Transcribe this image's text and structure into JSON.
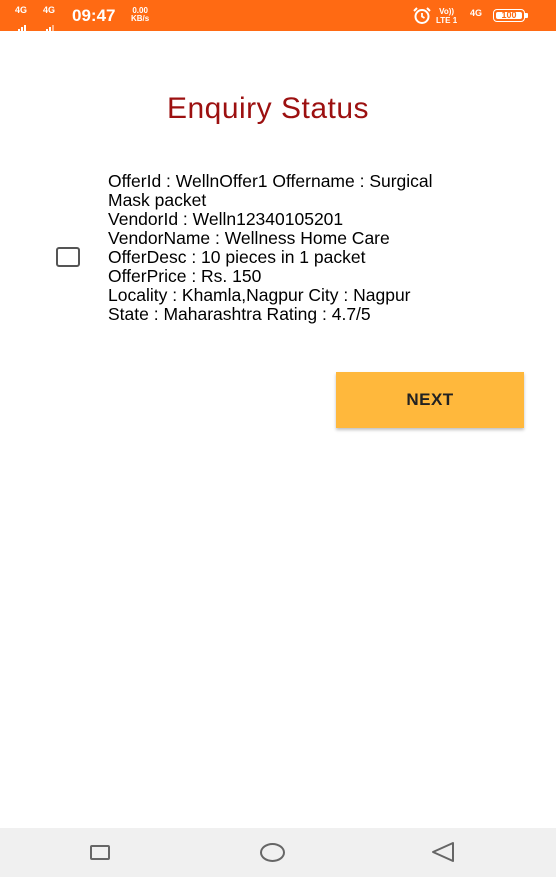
{
  "status_bar": {
    "network_1": "4G",
    "network_2": "4G",
    "time": "09:47",
    "speed_value": "0.00",
    "speed_unit": "KB/s",
    "volte_top": "Vo))",
    "volte_bottom": "LTE 1",
    "network_3": "4G",
    "battery": "100",
    "icons": [
      "signal-bars-icon",
      "alarm-clock-icon",
      "battery-icon"
    ],
    "background_color": "#ff6a13"
  },
  "page": {
    "title": "Enquiry Status",
    "title_color": "#9c1010"
  },
  "offer": {
    "checked": false,
    "lines": [
      "OfferId : WellnOffer1 Offername : Surgical",
      "Mask packet",
      "VendorId : Welln12340105201",
      "VendorName : Wellness Home Care",
      "OfferDesc : 10 pieces in 1 packet",
      "OfferPrice : Rs. 150",
      "Locality : Khamla,Nagpur City : Nagpur",
      "State : Maharashtra Rating : 4.7/5"
    ]
  },
  "actions": {
    "next_label": "NEXT",
    "next_color": "#ffb83c"
  },
  "nav_bar": {
    "icons": [
      "recent-apps-icon",
      "home-icon",
      "back-icon"
    ]
  }
}
